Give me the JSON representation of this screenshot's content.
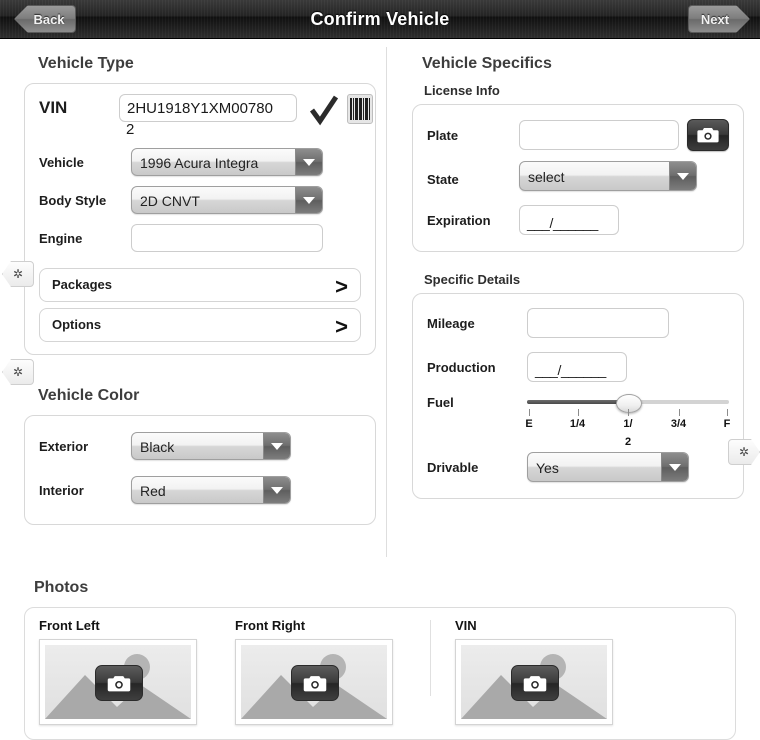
{
  "header": {
    "back_label": "Back",
    "title": "Confirm Vehicle",
    "next_label": "Next"
  },
  "left_column": {
    "vehicle_type": {
      "heading": "Vehicle Type",
      "vin": {
        "label": "VIN",
        "value": "2HU1918Y1XM00780",
        "overflow": "2",
        "full_value": "2HU1918Y1XM007802",
        "validated": true,
        "check_icon": "checkmark-icon",
        "scan_icon": "barcode-icon"
      },
      "vehicle": {
        "label": "Vehicle",
        "value": "1996 Acura Integra"
      },
      "body_style": {
        "label": "Body Style",
        "value": "2D CNVT"
      },
      "engine": {
        "label": "Engine",
        "value": ""
      },
      "packages_label": "Packages",
      "options_label": "Options",
      "chevron": ">"
    },
    "vehicle_color": {
      "heading": "Vehicle Color",
      "exterior": {
        "label": "Exterior",
        "value": "Black"
      },
      "interior": {
        "label": "Interior",
        "value": "Red"
      }
    }
  },
  "right_column": {
    "heading": "Vehicle Specifics",
    "license_info": {
      "heading": "License Info",
      "plate": {
        "label": "Plate",
        "value": "",
        "camera_icon": "camera-icon"
      },
      "state": {
        "label": "State",
        "value": "select"
      },
      "expiration": {
        "label": "Expiration",
        "value": "___/______"
      }
    },
    "specific_details": {
      "heading": "Specific Details",
      "mileage": {
        "label": "Mileage",
        "value": ""
      },
      "production": {
        "label": "Production",
        "value": "___/______"
      },
      "fuel": {
        "label": "Fuel",
        "position_percent": 50,
        "ticks": [
          "E",
          "1/4",
          "1/",
          "3/4",
          "F"
        ],
        "tick_overflow": "2"
      },
      "drivable": {
        "label": "Drivable",
        "value": "Yes"
      }
    }
  },
  "photos": {
    "heading": "Photos",
    "items": [
      {
        "label": "Front Left",
        "camera_icon": "camera-icon"
      },
      {
        "label": "Front Right",
        "camera_icon": "camera-icon"
      },
      {
        "label": "VIN",
        "camera_icon": "camera-icon"
      }
    ]
  },
  "markers": {
    "glyph": "✲"
  }
}
